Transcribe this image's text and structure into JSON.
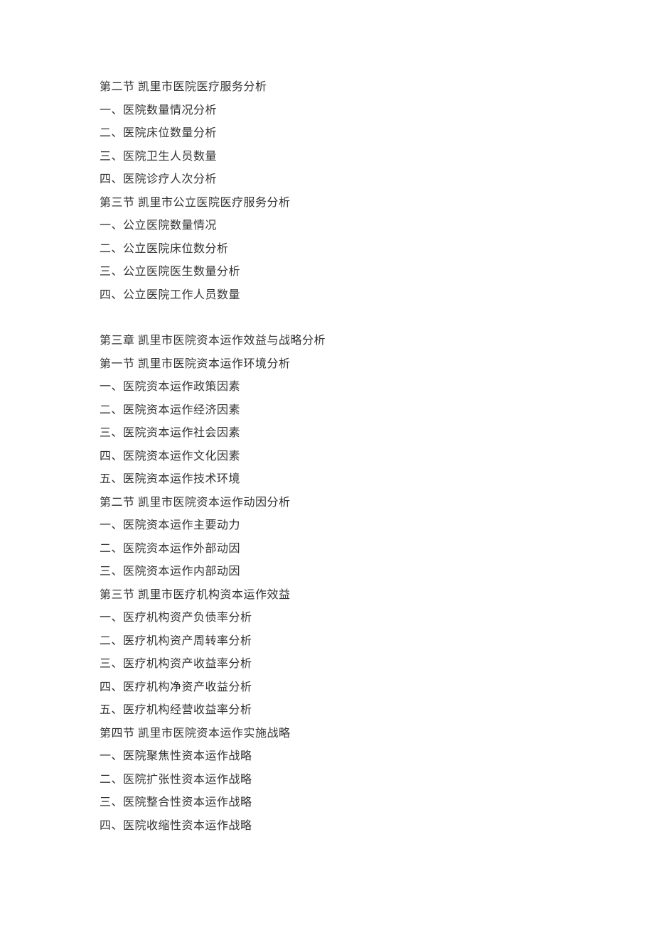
{
  "lines": [
    "第二节 凯里市医院医疗服务分析",
    "一、医院数量情况分析",
    "二、医院床位数量分析",
    "三、医院卫生人员数量",
    "四、医院诊疗人次分析",
    "第三节 凯里市公立医院医疗服务分析",
    "一、公立医院数量情况",
    "二、公立医院床位数分析",
    "三、公立医院医生数量分析",
    "四、公立医院工作人员数量",
    "",
    "第三章 凯里市医院资本运作效益与战略分析",
    "第一节 凯里市医院资本运作环境分析",
    "一、医院资本运作政策因素",
    "二、医院资本运作经济因素",
    "三、医院资本运作社会因素",
    "四、医院资本运作文化因素",
    "五、医院资本运作技术环境",
    "第二节 凯里市医院资本运作动因分析",
    "一、医院资本运作主要动力",
    "二、医院资本运作外部动因",
    "三、医院资本运作内部动因",
    "第三节 凯里市医疗机构资本运作效益",
    "一、医疗机构资产负债率分析",
    "二、医疗机构资产周转率分析",
    "三、医疗机构资产收益率分析",
    "四、医疗机构净资产收益分析",
    "五、医疗机构经营收益率分析",
    "第四节 凯里市医院资本运作实施战略",
    "一、医院聚焦性资本运作战略",
    "二、医院扩张性资本运作战略",
    "三、医院整合性资本运作战略",
    "四、医院收缩性资本运作战略"
  ]
}
